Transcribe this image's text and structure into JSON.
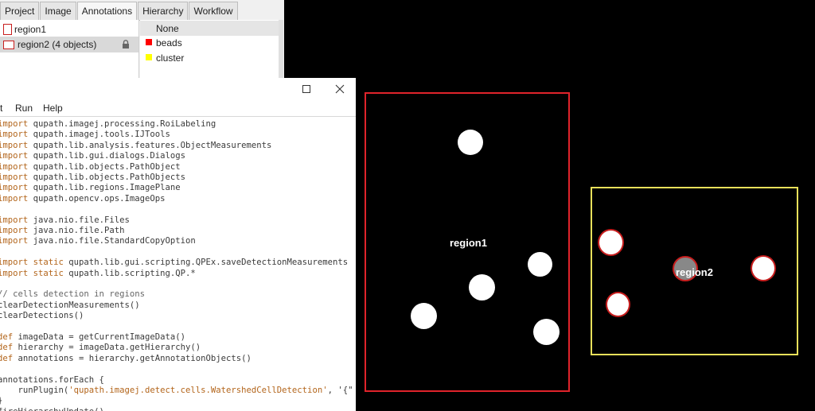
{
  "tabs": [
    "Project",
    "Image",
    "Annotations",
    "Hierarchy",
    "Workflow"
  ],
  "active_tab": "Annotations",
  "annotations": [
    {
      "label": "region1"
    },
    {
      "label": "region2 (4 objects)",
      "locked": true
    }
  ],
  "classes": [
    {
      "label": "None",
      "color": ""
    },
    {
      "label": "beads",
      "color": "#ff0000"
    },
    {
      "label": "cluster",
      "color": "#ffff00"
    }
  ],
  "editor": {
    "menu": [
      "t",
      "Run",
      "Help"
    ]
  },
  "code_lines": [
    {
      "kw": "import",
      "rest": " qupath.imagej.processing.RoiLabeling"
    },
    {
      "kw": "import",
      "rest": " qupath.imagej.tools.IJTools"
    },
    {
      "kw": "import",
      "rest": " qupath.lib.analysis.features.ObjectMeasurements"
    },
    {
      "kw": "import",
      "rest": " qupath.lib.gui.dialogs.Dialogs"
    },
    {
      "kw": "import",
      "rest": " qupath.lib.objects.PathObject"
    },
    {
      "kw": "import",
      "rest": " qupath.lib.objects.PathObjects"
    },
    {
      "kw": "import",
      "rest": " qupath.lib.regions.ImagePlane"
    },
    {
      "kw": "import",
      "rest": " qupath.opencv.ops.ImageOps"
    },
    {
      "kw": "",
      "rest": ""
    },
    {
      "kw": "import",
      "rest": " java.nio.file.Files"
    },
    {
      "kw": "import",
      "rest": " java.nio.file.Path"
    },
    {
      "kw": "import",
      "rest": " java.nio.file.StandardCopyOption"
    },
    {
      "kw": "",
      "rest": ""
    },
    {
      "kw": "import static",
      "rest": " qupath.lib.gui.scripting.QPEx.saveDetectionMeasurements"
    },
    {
      "kw": "import static",
      "rest": " qupath.lib.scripting.QP.*"
    },
    {
      "kw": "",
      "rest": ""
    },
    {
      "kw": "",
      "rest": "// cells detection in regions",
      "comment": true
    },
    {
      "kw": "",
      "rest": "clearDetectionMeasurements()"
    },
    {
      "kw": "",
      "rest": "clearDetections()"
    },
    {
      "kw": "",
      "rest": ""
    },
    {
      "kw": "def",
      "rest": " imageData = getCurrentImageData()"
    },
    {
      "kw": "def",
      "rest": " hierarchy = imageData.getHierarchy()"
    },
    {
      "kw": "def",
      "rest": " annotations = hierarchy.getAnnotationObjects()"
    },
    {
      "kw": "",
      "rest": ""
    },
    {
      "kw": "",
      "rest": "annotations.forEach {"
    },
    {
      "kw": "",
      "rest": "    runPlugin(",
      "str": "'qupath.imagej.detect.cells.WatershedCellDetection'",
      "tail": ", '{\""
    },
    {
      "kw": "",
      "rest": "}"
    },
    {
      "kw": "",
      "rest": "fireHierarchyUpdate()"
    }
  ],
  "viewer": {
    "region1_label": "region1",
    "region2_label": "region2",
    "region1_color": "#e0232b",
    "region2_color": "#e8e05a"
  }
}
